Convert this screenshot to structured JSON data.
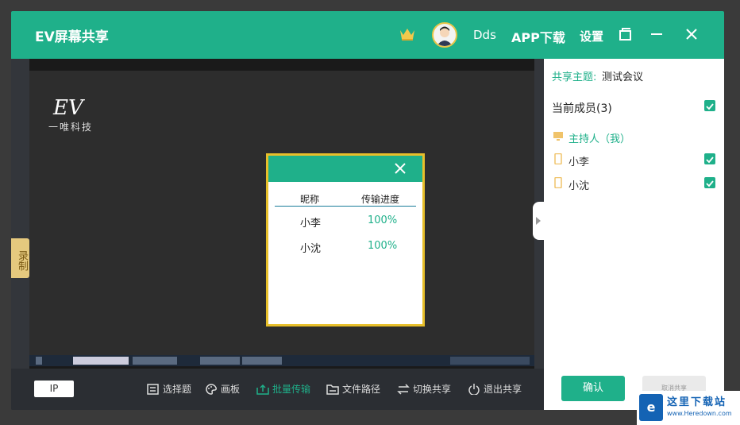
{
  "titlebar": {
    "app_title": "EV屏幕共享",
    "username": "Dds",
    "app_download": "APP下载",
    "settings": "设置"
  },
  "screen": {
    "logo_text": "EV",
    "logo_sub": "一唯科技",
    "record_tab": "录制"
  },
  "transfer_dialog": {
    "col_nickname": "昵称",
    "col_progress": "传输进度",
    "rows": [
      {
        "name": "小李",
        "progress": "100%"
      },
      {
        "name": "小沈",
        "progress": "100%"
      }
    ]
  },
  "toolbar": {
    "ip": "IP",
    "items": [
      {
        "label": "选择题",
        "icon": "list-icon"
      },
      {
        "label": "画板",
        "icon": "palette-icon"
      },
      {
        "label": "批量传输",
        "icon": "upload-icon",
        "active": true
      },
      {
        "label": "文件路径",
        "icon": "folder-icon"
      },
      {
        "label": "切换共享",
        "icon": "switch-icon"
      },
      {
        "label": "退出共享",
        "icon": "power-icon"
      }
    ]
  },
  "panel": {
    "topic_label": "共享主题:",
    "topic_value": "测试会议",
    "members_title": "当前成员(3)",
    "members": [
      {
        "name": "主持人（我）",
        "type": "host"
      },
      {
        "name": "小李",
        "type": "device",
        "checked": true
      },
      {
        "name": "小沈",
        "type": "device",
        "checked": true
      }
    ],
    "confirm": "确认",
    "cancel": "取消共享"
  },
  "watermark": {
    "title": "这里下载站",
    "url": "www.Heredown.com"
  },
  "colors": {
    "accent": "#1fb08a",
    "dialog_border": "#e7bf2a",
    "record_tab": "#e5c97e"
  }
}
